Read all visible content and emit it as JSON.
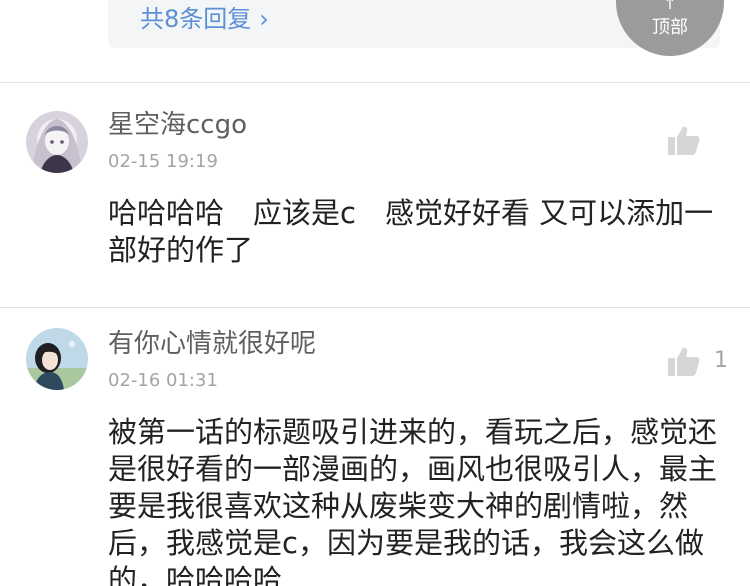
{
  "replies": {
    "more_label": "共8条回复",
    "chevron": "›"
  },
  "to_top": {
    "label": "顶部",
    "arrow": "↑"
  },
  "comments": [
    {
      "username": "星空海ccgo",
      "time": "02-15 19:19",
      "likes": "",
      "content": "哈哈哈哈　应该是c　感觉好好看  又可以添加一部好的作了"
    },
    {
      "username": "有你心情就很好呢",
      "time": "02-16 01:31",
      "likes": "1",
      "content": "被第一话的标题吸引进来的，看玩之后，感觉还是很好看的一部漫画的，画风也很吸引人，最主要是我很喜欢这种从废柴变大神的剧情啦，然后，我感觉是c，因为要是我的话，我会这么做的，哈哈哈哈"
    }
  ],
  "icons": {
    "like": "thumbs-up-icon",
    "avatar_1": "anime-avatar",
    "avatar_2": "girl-avatar"
  }
}
